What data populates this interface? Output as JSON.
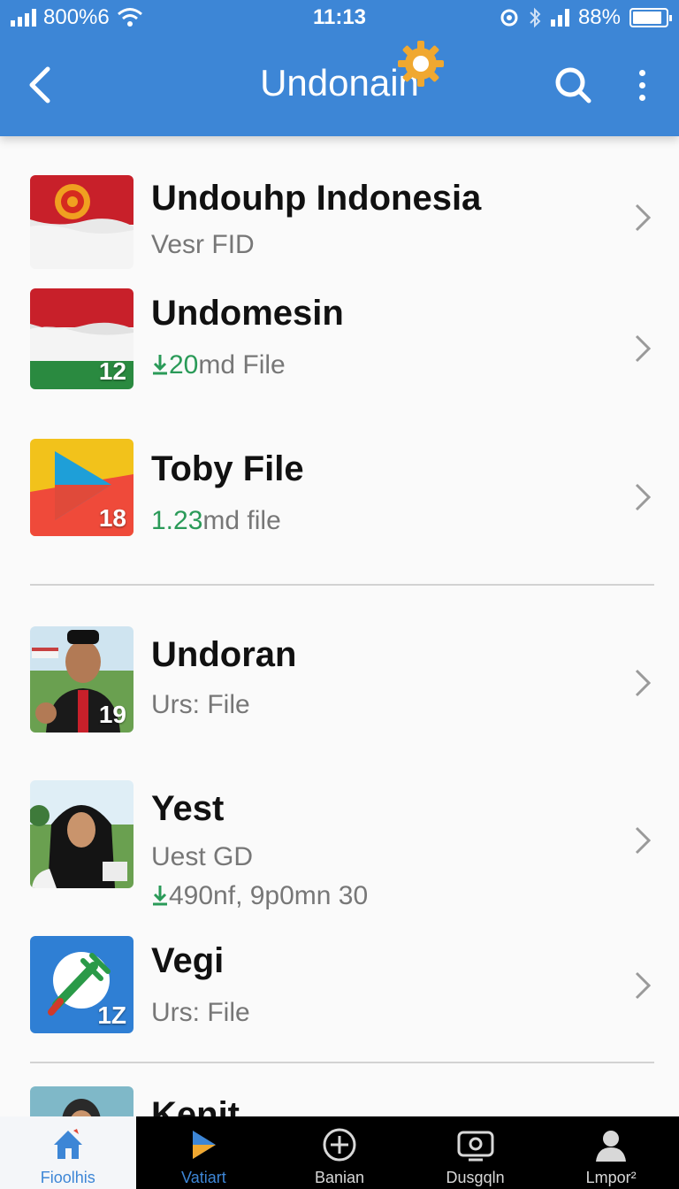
{
  "status_bar": {
    "data_label": "800%6",
    "time": "11:13",
    "battery": "88%",
    "battery_level": 0.88
  },
  "header": {
    "title": "Undonain",
    "icons": [
      "back-icon",
      "gear-icon",
      "search-icon",
      "more-icon"
    ]
  },
  "items": [
    {
      "title": "Undouhp  Indonesia",
      "subtitle": "Vesr FID",
      "badge": "",
      "thumb": "indonesia-flag-emblem"
    },
    {
      "title": "Undomesin",
      "subtitle_dl": "20",
      "subtitle_rest": "md File",
      "badge": "12",
      "thumb": "red-white-green-flag"
    },
    {
      "title": "Toby File",
      "subtitle_dl": "1.23",
      "subtitle_rest": "md file",
      "badge": "18",
      "thumb": "play-triangle"
    },
    {
      "title": "Undoran",
      "subtitle": "Urs: File",
      "badge": "19",
      "thumb": "man-photo"
    },
    {
      "title": "Yest",
      "subtitle": "Uest GD",
      "subtitle2": "490nf, 9p0mn 30",
      "badge": "",
      "thumb": "woman-photo"
    },
    {
      "title": "Vegi",
      "subtitle": "Urs: File",
      "badge": "1Z",
      "thumb": "fork-circle"
    },
    {
      "title": "Kenit",
      "subtitle": "",
      "badge": "",
      "thumb": "person-photo"
    }
  ],
  "bottom_nav": [
    {
      "label": "Fioolhis",
      "icon": "home-icon"
    },
    {
      "label": "Vatiart",
      "icon": "play-icon"
    },
    {
      "label": "Banian",
      "icon": "plus-circle-icon"
    },
    {
      "label": "Dusgqln",
      "icon": "screen-icon"
    },
    {
      "label": "Lmpor²",
      "icon": "user-icon"
    }
  ],
  "colors": {
    "header": "#3d86d6",
    "download_green": "#2a9a58",
    "nav_bg": "#000000"
  }
}
